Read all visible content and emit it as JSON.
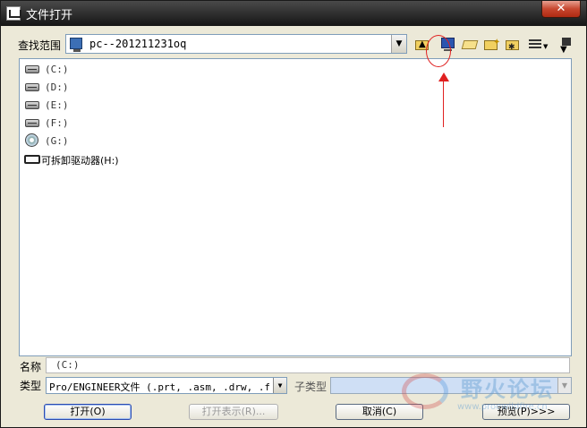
{
  "window": {
    "title": "文件打开",
    "close_label": "✕"
  },
  "lookin": {
    "label": "查找范围",
    "value": "pc--201211231oq"
  },
  "toolbar": {
    "icons": [
      "up-folder-icon",
      "desktop-icon",
      "open-folder-icon",
      "new-folder-icon",
      "favorites-folder-icon",
      "view-menu-icon",
      "download-icon"
    ]
  },
  "files": [
    {
      "name": "(C:)",
      "icon": "hard-drive-icon"
    },
    {
      "name": "(D:)",
      "icon": "hard-drive-icon"
    },
    {
      "name": "(E:)",
      "icon": "hard-drive-icon"
    },
    {
      "name": "(F:)",
      "icon": "hard-drive-icon"
    },
    {
      "name": "(G:)",
      "icon": "cd-drive-icon"
    },
    {
      "name": "可拆卸驱动器(H:)",
      "icon": "removable-drive-icon"
    }
  ],
  "name_field": {
    "label": "名称",
    "value": "(C:)"
  },
  "type_field": {
    "label": "类型",
    "value": "Pro/ENGINEER文件 (.prt, .asm, .drw, .frm,"
  },
  "subtype_field": {
    "label": "子类型",
    "value": ""
  },
  "buttons": {
    "open": "打开(O)",
    "open_rep": "打开表示(R)...",
    "cancel": "取消(C)",
    "preview": "预览(P)>>>"
  },
  "watermark": {
    "text": "野火论坛",
    "url": "www.proewildfire.cn"
  },
  "colors": {
    "annotation": "#e02020",
    "dialog_bg": "#ece9d8"
  }
}
